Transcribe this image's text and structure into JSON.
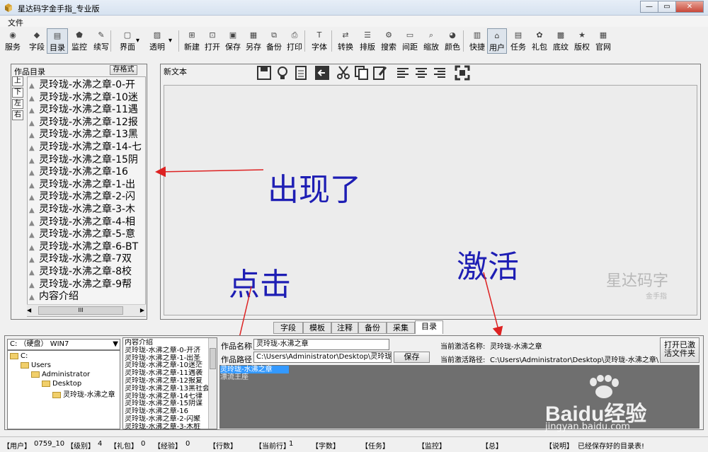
{
  "window": {
    "title": "星达码字金手指_专业版",
    "min": "—",
    "max": "▭",
    "close": "✕"
  },
  "menu": {
    "file": "文件"
  },
  "toolbar": {
    "items": [
      {
        "label": "服务",
        "icon": "rss-icon",
        "glyph": "◉"
      },
      {
        "label": "字段",
        "icon": "diamond-icon",
        "glyph": "◆"
      },
      {
        "label": "目录",
        "icon": "folder-icon",
        "glyph": "▤"
      },
      {
        "label": "监控",
        "icon": "shield-icon",
        "glyph": "⬟"
      },
      {
        "label": "续写",
        "icon": "pen-icon",
        "glyph": "✎"
      },
      {
        "label": "界面",
        "icon": "window-icon",
        "glyph": "▢"
      },
      {
        "label": "透明",
        "icon": "image-icon",
        "glyph": "▨"
      },
      {
        "label": "新建",
        "icon": "new-file-icon",
        "glyph": "⊞"
      },
      {
        "label": "打开",
        "icon": "open-icon",
        "glyph": "⊡"
      },
      {
        "label": "保存",
        "icon": "save-icon",
        "glyph": "▣"
      },
      {
        "label": "另存",
        "icon": "save-as-icon",
        "glyph": "▦"
      },
      {
        "label": "备份",
        "icon": "backup-icon",
        "glyph": "⧉"
      },
      {
        "label": "打印",
        "icon": "print-icon",
        "glyph": "⎙"
      },
      {
        "label": "字体",
        "icon": "font-icon",
        "glyph": "T"
      },
      {
        "label": "转换",
        "icon": "convert-icon",
        "glyph": "⇄"
      },
      {
        "label": "排版",
        "icon": "layout-icon",
        "glyph": "☰"
      },
      {
        "label": "搜索",
        "icon": "search-icon",
        "glyph": "⚙"
      },
      {
        "label": "间距",
        "icon": "spacing-icon",
        "glyph": "▭"
      },
      {
        "label": "缩放",
        "icon": "zoom-icon",
        "glyph": "⌕"
      },
      {
        "label": "颜色",
        "icon": "palette-icon",
        "glyph": "◕"
      },
      {
        "label": "快捷",
        "icon": "shortcut-icon",
        "glyph": "▥"
      },
      {
        "label": "用户",
        "icon": "user-icon",
        "glyph": "⌂"
      },
      {
        "label": "任务",
        "icon": "task-icon",
        "glyph": "▤"
      },
      {
        "label": "礼包",
        "icon": "gift-icon",
        "glyph": "✿"
      },
      {
        "label": "底纹",
        "icon": "texture-icon",
        "glyph": "▩"
      },
      {
        "label": "版权",
        "icon": "star-icon",
        "glyph": "★"
      },
      {
        "label": "官网",
        "icon": "web-icon",
        "glyph": "▦"
      }
    ]
  },
  "left_panel": {
    "title": "作品目录",
    "save_format": "存格式",
    "side_buttons": [
      "上",
      "下",
      "左",
      "右"
    ],
    "items": [
      "灵玲珑-水沸之章-0-开",
      "灵玲珑-水沸之章-10迷",
      "灵玲珑-水沸之章-11遇",
      "灵玲珑-水沸之章-12报",
      "灵玲珑-水沸之章-13黑",
      "灵玲珑-水沸之章-14-七",
      "灵玲珑-水沸之章-15阴",
      "灵玲珑-水沸之章-16",
      "灵玲珑-水沸之章-1-出",
      "灵玲珑-水沸之章-2-闪",
      "灵玲珑-水沸之章-3-木",
      "灵玲珑-水沸之章-4-相",
      "灵玲珑-水沸之章-5-意",
      "灵玲珑-水沸之章-6-BT",
      "灵玲珑-水沸之章-7双",
      "灵玲珑-水沸之章-8校",
      "灵玲珑-水沸之章-9帮",
      "内容介绍"
    ],
    "scroll_grip": "III"
  },
  "editor": {
    "title": "新文本",
    "watermark_main": "星达码字",
    "watermark_sub": "金手指"
  },
  "annotations": {
    "appeared": "出现了",
    "click": "点击",
    "activate": "激活"
  },
  "tabs": [
    "字段",
    "模板",
    "注释",
    "备份",
    "采集",
    "目录"
  ],
  "bottom": {
    "drive_select": "C: （硬盘） WIN7",
    "tree": [
      "C:",
      "Users",
      "Administrator",
      "Desktop",
      "灵玲珑-水沸之章"
    ],
    "intro_list": [
      "内容介绍",
      "灵玲珑-水沸之章-0-开济",
      "灵玲珑-水沸之章-1-出圣",
      "灵玲珑-水沸之章-10迷茫",
      "灵玲珑-水沸之章-11遇袭",
      "灵玲珑-水沸之章-12报复",
      "灵玲珑-水沸之章-13黑社会",
      "灵玲珑-水沸之章-14七律",
      "灵玲珑-水沸之章-15阴谋",
      "灵玲珑-水沸之章-16",
      "灵玲珑-水沸之章-2-闪聚",
      "灵玲珑-水沸之章-3-木桩"
    ],
    "work_name_label": "作品名称",
    "work_name_value": "灵玲珑-水沸之章",
    "work_path_label": "作品路径",
    "work_path_value": "C:\\Users\\Administrator\\Desktop\\灵玲珑-水",
    "save_button": "保存",
    "active_name_label": "当前激活名称:",
    "active_name_value": "灵玲珑-水沸之章",
    "active_path_label": "当前激活路径:",
    "active_path_value": "C:\\Users\\Administrator\\Desktop\\灵玲珑-水沸之章\\",
    "open_activated_button_line1": "打开已激",
    "open_activated_button_line2": "活文件夹",
    "works": [
      {
        "name": "灵玲珑-水沸之章",
        "selected": true
      },
      {
        "name": "漂流王座",
        "selected": false
      }
    ]
  },
  "status": {
    "user_label": "【用户】",
    "user_value": "0759_10",
    "level_label": "【级别】",
    "level_value": "4",
    "gift_label": "【礼包】",
    "gift_value": "0",
    "exp_label": "【经验】",
    "exp_value": "0",
    "lines_label": "【行数】",
    "current_line_label": "【当前行】",
    "current_line_value": "1",
    "words_label": "【字数】",
    "task_label": "【任务】",
    "monitor_label": "【监控】",
    "total_label": "【总】",
    "note_label": "【说明】",
    "note_value": "已经保存好的目录表!"
  },
  "watermark": {
    "brand": "Baidu经验",
    "url": "jingyan.baidu.com"
  }
}
